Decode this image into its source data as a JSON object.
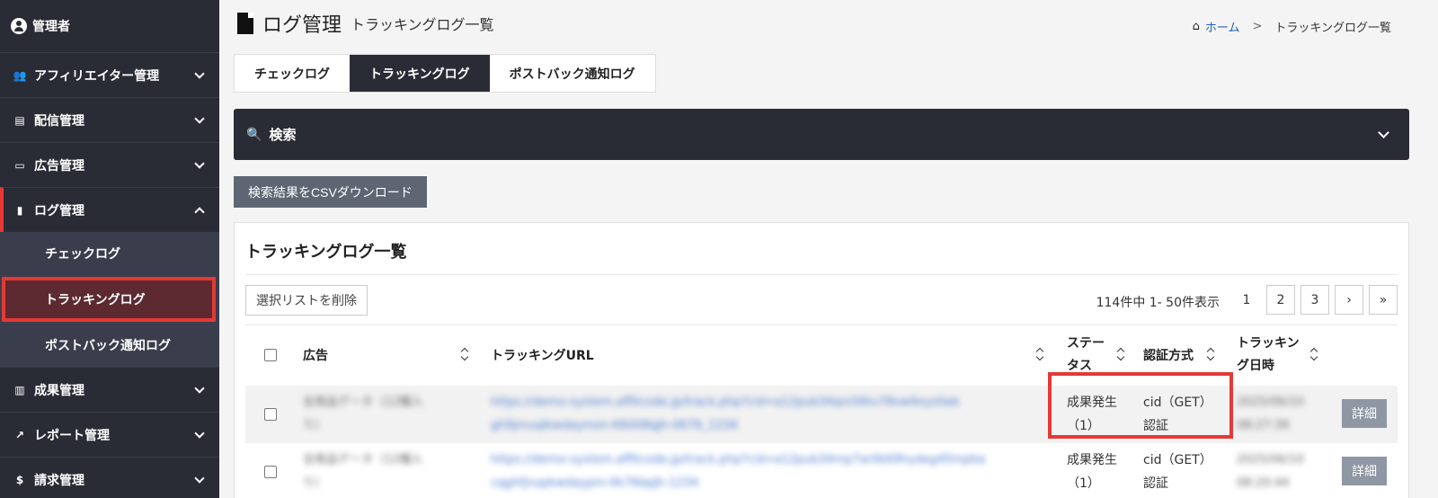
{
  "sidebar": {
    "user": "管理者",
    "items": [
      {
        "label": "アフィリエイター管理",
        "icon": "users-icon"
      },
      {
        "label": "配信管理",
        "icon": "delivery-icon"
      },
      {
        "label": "広告管理",
        "icon": "ad-icon"
      },
      {
        "label": "ログ管理",
        "icon": "file-icon"
      },
      {
        "label": "成果管理",
        "icon": "bar-chart-icon"
      },
      {
        "label": "レポート管理",
        "icon": "line-chart-icon"
      },
      {
        "label": "請求管理",
        "icon": "dollar-icon"
      }
    ],
    "sub_items": [
      "チェックログ",
      "トラッキングログ",
      "ポストバック通知ログ"
    ]
  },
  "header": {
    "title": "ログ管理",
    "subtitle": "トラッキングログ一覧",
    "breadcrumb_home": "ホーム",
    "breadcrumb_sep": ">",
    "breadcrumb_current": "トラッキングログ一覧"
  },
  "tabs": [
    "チェックログ",
    "トラッキングログ",
    "ポストバック通知ログ"
  ],
  "search": {
    "label": "検索"
  },
  "csv_button": "検索結果をCSVダウンロード",
  "list": {
    "title": "トラッキングログ一覧",
    "delete_button": "選択リストを削除",
    "count_text": "114件中 1- 50件表示",
    "pages": [
      "1",
      "2",
      "3",
      "›",
      "»"
    ],
    "columns": {
      "ad": "広告",
      "url": "トラッキングURL",
      "status_1": "ステー",
      "status_2": "タス",
      "auth": "認証方式",
      "date_1": "トラッキン",
      "date_2": "グ日時"
    },
    "rows": [
      {
        "ad_1": "全商品データ（12種入",
        "ad_2": "り）",
        "url_1": "https://demo-system.affitcode.jp/track.php?cid=a12pub34qrs56tu78vw9xyz0ab",
        "url_2": "gh9jmuqlkwdaymzn-K6008qJh-0676_1234",
        "status_1": "成果発生",
        "status_2": "（1）",
        "auth_1": "cid（GET）",
        "auth_2": "認証",
        "date_1": "2025/06/10",
        "date_2": "08:27:39",
        "detail": "詳細"
      },
      {
        "ad_1": "全商品データ（12種入",
        "ad_2": "り）",
        "url_1": "https://demo-system.affitcode.jp/track.php?cid=a12pub34mp7ar0k69hydeg45mpba",
        "url_2": "cqghfjnupkwdaypm-0k76bpJh-1234",
        "status_1": "成果発生",
        "status_2": "（1）",
        "auth_1": "cid（GET）",
        "auth_2": "認証",
        "date_1": "2025/06/10",
        "date_2": "08:20:44",
        "detail": "詳細"
      }
    ]
  },
  "colors": {
    "sidebar_bg": "#2a2c35",
    "accent_red": "#e53935",
    "link_blue": "#1f5fbf"
  }
}
